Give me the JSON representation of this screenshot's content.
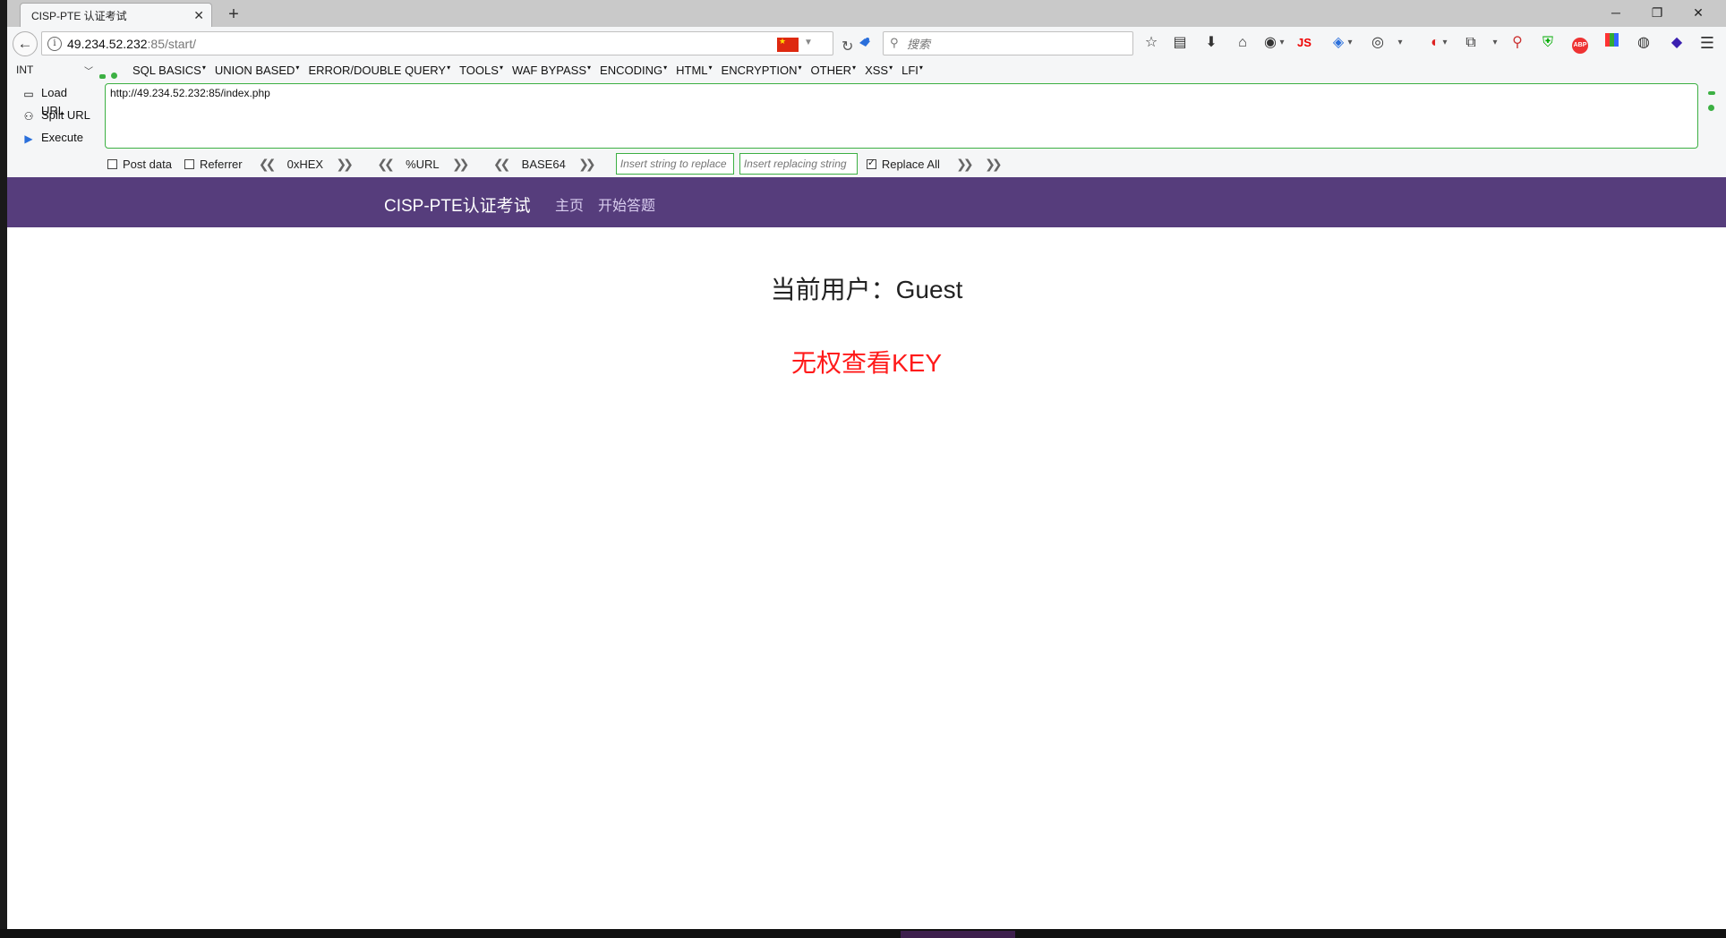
{
  "browser": {
    "tab_title": "CISP-PTE 认证考试",
    "tab_close": "✕",
    "new_tab": "+",
    "window_controls": {
      "minimize": "─",
      "restore": "❐",
      "close": "✕"
    },
    "url_host": "49.234.52.232",
    "url_rest": ":85/start/",
    "search_placeholder": "搜索",
    "toolbar_js_label": "JS"
  },
  "hackbar": {
    "select_value": "INT",
    "menu": [
      "SQL BASICS",
      "UNION BASED",
      "ERROR/DOUBLE QUERY",
      "TOOLS",
      "WAF BYPASS",
      "ENCODING",
      "HTML",
      "ENCRYPTION",
      "OTHER",
      "XSS",
      "LFI"
    ],
    "actions": {
      "load": "Load URL",
      "split": "Split URL",
      "execute": "Execute"
    },
    "url_value": "http://49.234.52.232:85/index.php",
    "post_data": "Post data",
    "referrer": "Referrer",
    "hex": "0xHEX",
    "url_enc": "%URL",
    "base64": "BASE64",
    "replace_placeholder": "Insert string to replace",
    "replacing_placeholder": "Insert replacing string",
    "replace_all": "Replace All",
    "colors": {
      "accent_green": "#3cb043"
    }
  },
  "site": {
    "brand": "CISP-PTE认证考试",
    "nav": [
      "主页",
      "开始答题"
    ],
    "current_user_label": "当前用户：Guest",
    "no_permission": "无权查看KEY",
    "colors": {
      "navbar": "#563d7c",
      "warning": "#ff1a1a"
    }
  }
}
